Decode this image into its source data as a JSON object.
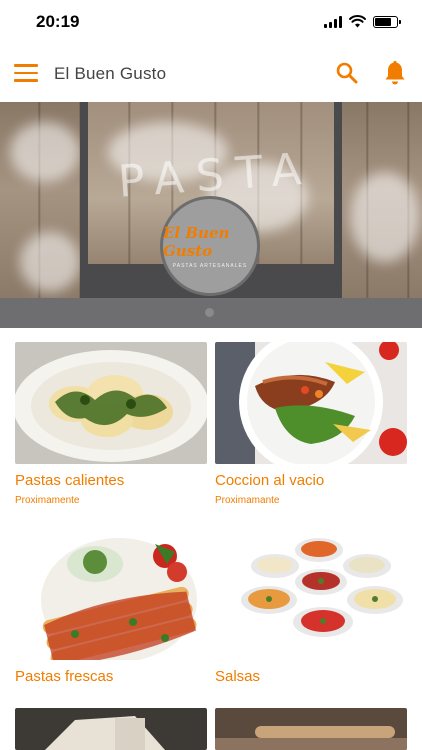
{
  "status_bar": {
    "time": "20:19",
    "battery_level": 0.75
  },
  "app_bar": {
    "title": "El Buen Gusto",
    "accent": "#f07d00"
  },
  "banner": {
    "word": "PASTA",
    "logo_title": "El Buen Gusto",
    "logo_subtitle": "PASTAS ARTESANALES"
  },
  "categories": [
    {
      "title": "Pastas calientes",
      "subtitle": "Proximamente"
    },
    {
      "title": "Coccion al vacio",
      "subtitle": "Proximamante"
    },
    {
      "title": "Pastas frescas",
      "subtitle": ""
    },
    {
      "title": "Salsas",
      "subtitle": ""
    }
  ]
}
